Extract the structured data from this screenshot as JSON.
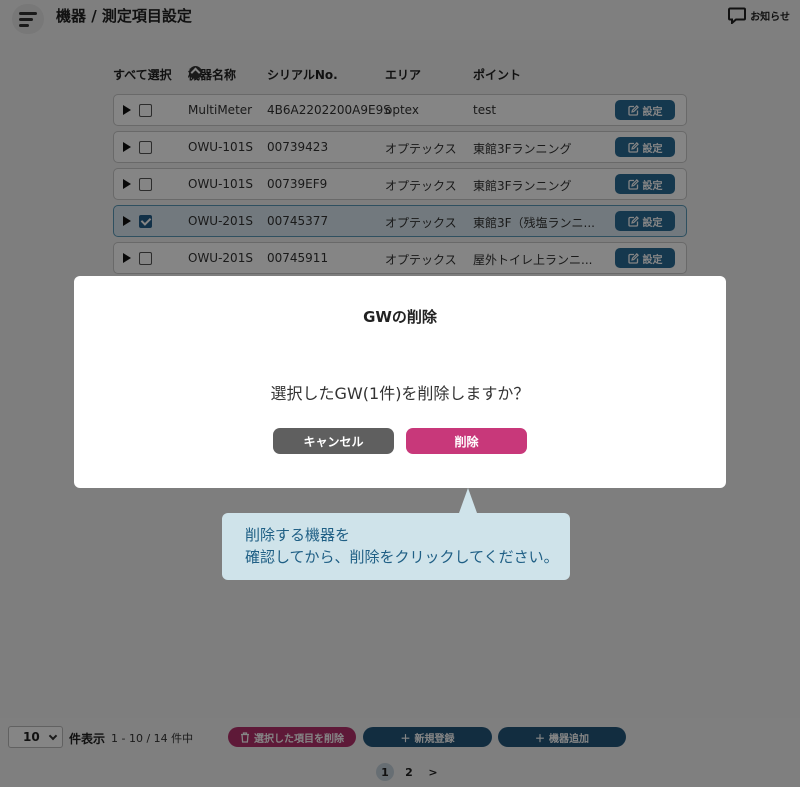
{
  "header": {
    "title": "機器 / 測定項目設定",
    "notice_label": "お知らせ"
  },
  "table": {
    "columns": {
      "select_all": "すべて選択",
      "device_name": "機器名称",
      "serial": "シリアルNo.",
      "area": "エリア",
      "point": "ポイント"
    },
    "settings_label": "設定",
    "rows": [
      {
        "name": "MultiMeter",
        "serial": "4B6A2202200A9E9S",
        "area": "optex",
        "point": "test",
        "checked": false
      },
      {
        "name": "OWU-101S",
        "serial": "00739423",
        "area": "オプテックス",
        "point": "東館3Fランニング",
        "checked": false
      },
      {
        "name": "OWU-101S",
        "serial": "00739EF9",
        "area": "オプテックス",
        "point": "東館3Fランニング",
        "checked": false
      },
      {
        "name": "OWU-201S",
        "serial": "00745377",
        "area": "オプテックス",
        "point": "東館3F（残塩ランニ...",
        "checked": true
      },
      {
        "name": "OWU-201S",
        "serial": "00745911",
        "area": "オプテックス",
        "point": "屋外トイレ上ランニ...",
        "checked": false
      }
    ]
  },
  "footer": {
    "per_page_value": "10",
    "per_page_label": "件表示",
    "range_text": "1 - 10 / 14 件中",
    "delete_selected_label": "選択した項目を削除",
    "new_register_label": "新規登録",
    "add_device_label": "機器追加",
    "pages": [
      "1",
      "2"
    ],
    "current_page": "1",
    "next_label": ">"
  },
  "modal": {
    "title": "GWの削除",
    "message": "選択したGW(1件)を削除しますか？",
    "cancel_label": "キャンセル",
    "confirm_label": "削除"
  },
  "tooltip": {
    "line1": "削除する機器を",
    "line2": "確認してから、削除をクリックしてください。"
  },
  "colors": {
    "primary": "#2a6b96",
    "danger": "#c8387a",
    "cancel": "#5f5f5f",
    "tooltip_bg": "#cfe3ea",
    "tooltip_text": "#1f5f85"
  }
}
